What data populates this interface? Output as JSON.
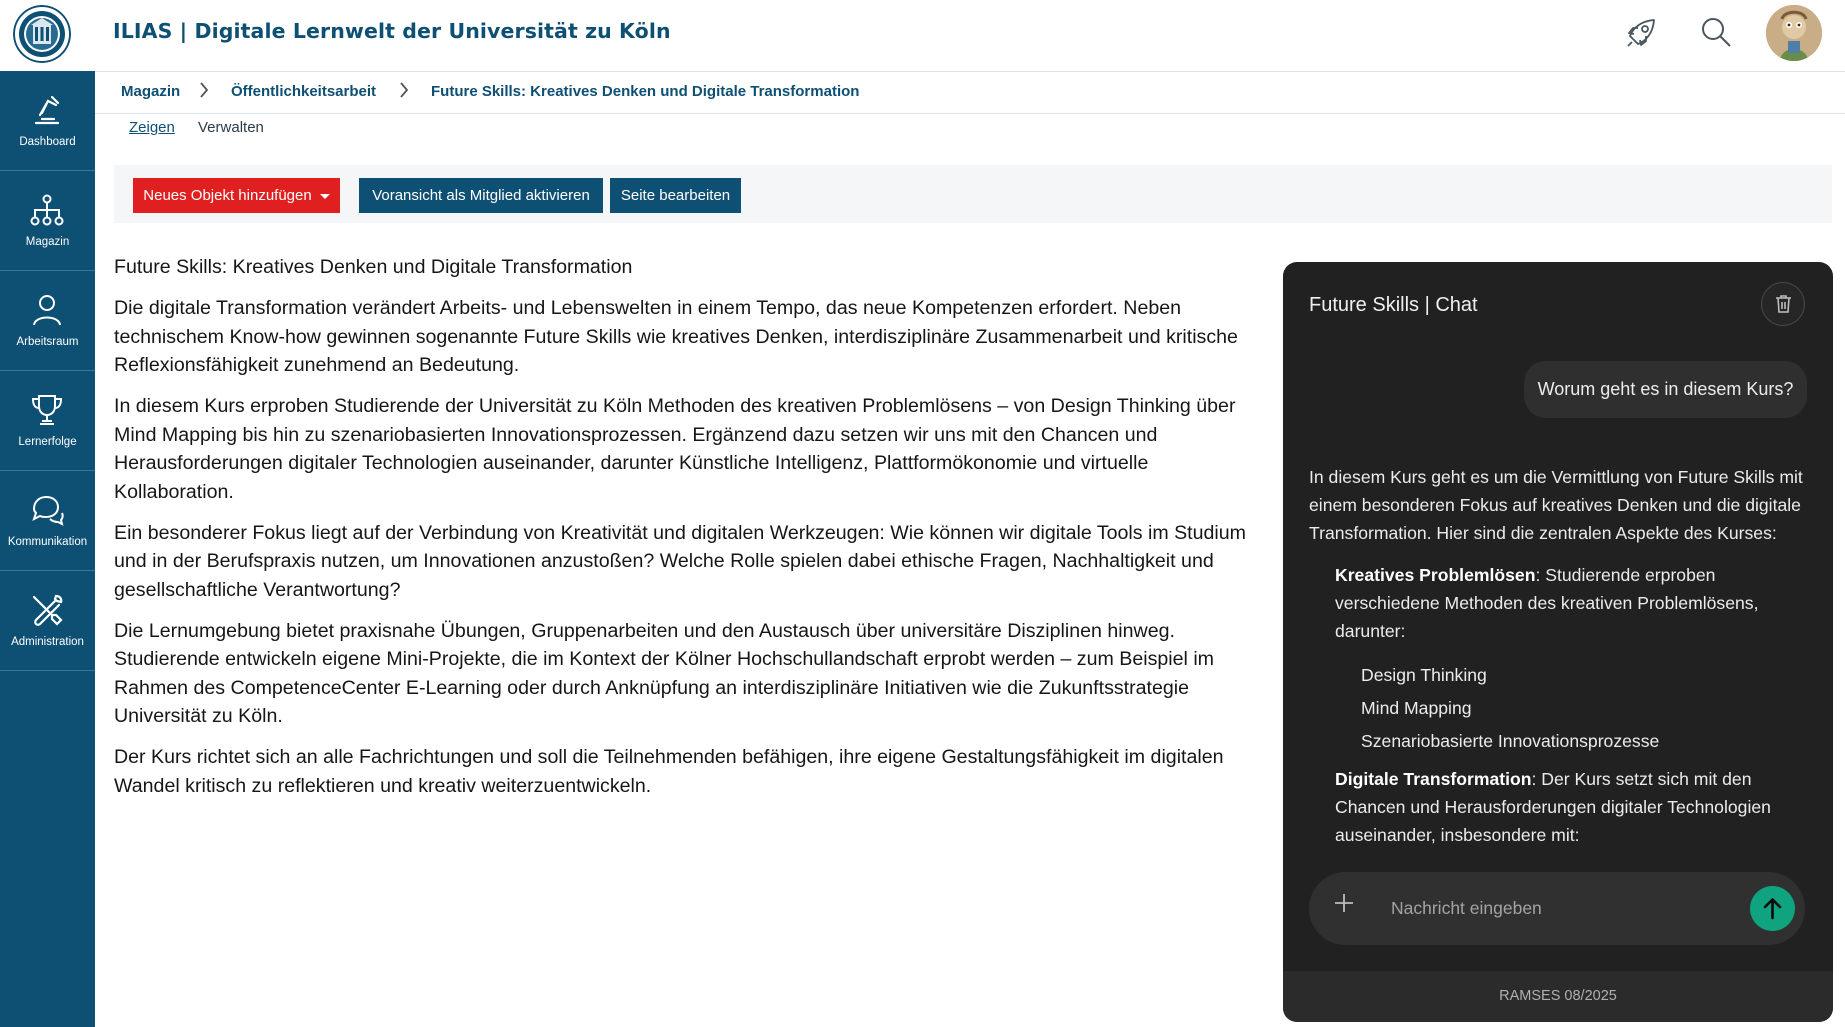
{
  "header": {
    "title": "ILIAS | Digitale Lernwelt der Universität zu Köln",
    "logo": "university-seal-logo",
    "icons": [
      "rocket-icon",
      "search-icon"
    ],
    "avatar": "user-avatar"
  },
  "sidebar": {
    "items": [
      {
        "label": "Dashboard",
        "icon": "dashboard-icon"
      },
      {
        "label": "Magazin",
        "icon": "repository-tree-icon"
      },
      {
        "label": "Arbeitsraum",
        "icon": "person-icon"
      },
      {
        "label": "Lernerfolge",
        "icon": "trophy-icon"
      },
      {
        "label": "Kommunikation",
        "icon": "chat-bubbles-icon"
      },
      {
        "label": "Administration",
        "icon": "tools-icon"
      }
    ]
  },
  "breadcrumb": {
    "items": [
      "Magazin",
      "Öffentlichkeitsarbeit",
      "Future Skills: Kreatives Denken und Digitale Transformation"
    ]
  },
  "tabs": {
    "show": "Zeigen",
    "manage": "Verwalten"
  },
  "toolbar": {
    "add_object": "Neues Objekt hinzufügen",
    "preview_member": "Voransicht als Mitglied aktivieren",
    "edit_page": "Seite bearbeiten"
  },
  "content": {
    "heading": "Future Skills: Kreatives Denken und Digitale Transformation",
    "paragraphs": [
      "Die digitale Transformation verändert Arbeits- und Lebenswelten in einem Tempo, das neue Kompetenzen erfordert. Neben technischem Know-how gewinnen sogenannte Future Skills wie kreatives Denken, interdisziplinäre Zusammenarbeit und kritische Reflexionsfähigkeit zunehmend an Bedeutung.",
      "In diesem Kurs erproben Studierende der Universität zu Köln Methoden des kreativen Problemlösens – von Design Thinking über Mind Mapping bis hin zu szenariobasierten Innovationsprozessen. Ergänzend dazu setzen wir uns mit den Chancen und Herausforderungen digitaler Technologien auseinander, darunter Künstliche Intelligenz, Plattformökonomie und virtuelle Kollaboration.",
      "Ein besonderer Fokus liegt auf der Verbindung von Kreativität und digitalen Werkzeugen: Wie können wir digitale Tools im Studium und in der Berufspraxis nutzen, um Innovationen anzustoßen? Welche Rolle spielen dabei ethische Fragen, Nachhaltigkeit und gesellschaftliche Verantwortung?",
      "Die Lernumgebung bietet praxisnahe Übungen, Gruppenarbeiten und den Austausch über universitäre Disziplinen hinweg. Studierende entwickeln eigene Mini-Projekte, die im Kontext der Kölner Hochschullandschaft erprobt werden – zum Beispiel im Rahmen des CompetenceCenter E-Learning oder durch Anknüpfung an interdisziplinäre Initiativen wie die Zukunftsstrategie Universität zu Köln.",
      "Der Kurs richtet sich an alle Fachrichtungen und soll die Teilnehmenden befähigen, ihre eigene Gestaltungsfähigkeit im digitalen Wandel kritisch zu reflektieren und kreativ weiterzuentwickeln."
    ]
  },
  "chat": {
    "title": "Future Skills | Chat",
    "user_message": "Worum geht es in diesem Kurs?",
    "bot_intro": "In diesem Kurs geht es um die Vermittlung von Future Skills mit einem besonderen Fokus auf kreatives Denken und die digitale Transformation. Hier sind die zentralen Aspekte des Kurses:",
    "section1_title": "Kreatives Problemlösen",
    "section1_text": ": Studierende erproben verschiedene Methoden des kreativen Problemlösens, darunter:",
    "section1_items": [
      "Design Thinking",
      "Mind Mapping",
      "Szenariobasierte Innovationsprozesse"
    ],
    "section2_title": "Digitale Transformation",
    "section2_text": ": Der Kurs setzt sich mit den Chancen und Herausforderungen digitaler Technologien auseinander, insbesondere mit:",
    "input_placeholder": "Nachricht eingeben",
    "footer": "RAMSES 08/2025",
    "send_color": "#10a37f"
  },
  "colors": {
    "brand": "#0e4f74",
    "danger": "#e02020"
  }
}
